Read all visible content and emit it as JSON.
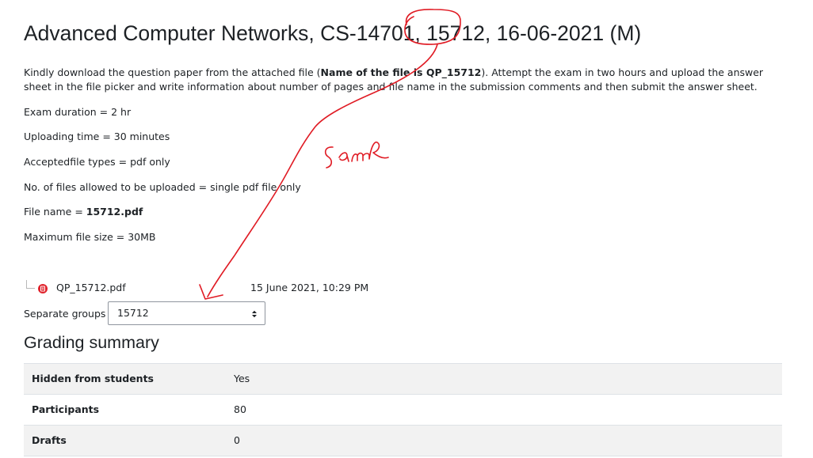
{
  "header": {
    "title": "Advanced Computer Networks, CS-14701, 15712, 16-06-2021 (M)"
  },
  "intro": {
    "before_bold": "Kindly download the question paper from the attached file (",
    "bold": "Name of the file is QP_15712",
    "after_bold": "). Attempt the exam in two hours and upload the answer sheet in the file picker and write information about number of pages and file name in the submission comments and then submit the answer sheet."
  },
  "info": {
    "duration": "Exam duration = 2 hr",
    "uploading_time": "Uploading time = 30 minutes",
    "file_types": "Acceptedfile types = pdf only",
    "files_allowed": "No. of files allowed to be uploaded = single pdf file only",
    "file_name_label": "File name = ",
    "file_name_value": "15712.pdf",
    "max_size": "Maximum file size = 30MB"
  },
  "attachment": {
    "icon": "pdf-icon",
    "file_name": "QP_15712.pdf",
    "date": "15 June 2021, 10:29 PM"
  },
  "groups": {
    "label": "Separate groups",
    "selected": "15712"
  },
  "grading": {
    "heading": "Grading summary",
    "rows": [
      {
        "label": "Hidden from students",
        "value": "Yes"
      },
      {
        "label": "Participants",
        "value": "80"
      },
      {
        "label": "Drafts",
        "value": "0"
      }
    ]
  },
  "annotation": {
    "text": "same",
    "color": "#e01b24"
  },
  "colors": {
    "text": "#1d2125",
    "pdf_icon": "#e0242d",
    "table_stripe": "#f2f2f2"
  }
}
